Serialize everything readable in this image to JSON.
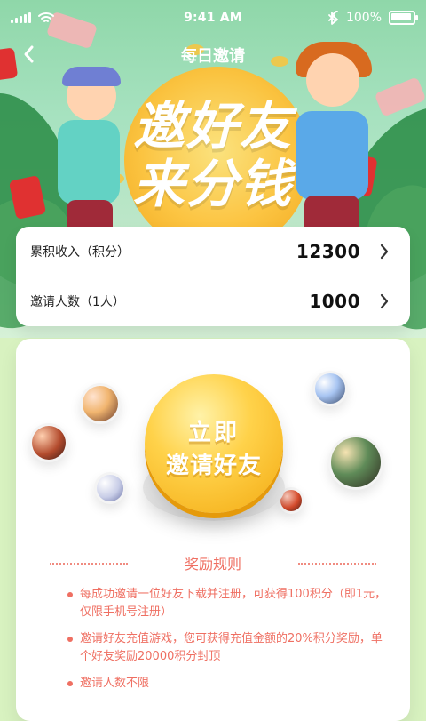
{
  "statusbar": {
    "time": "9:41 AM",
    "battery_text": "100%"
  },
  "nav": {
    "title": "每日邀请"
  },
  "hero": {
    "title_line1": "邀好友",
    "title_line2": "来分钱"
  },
  "stats": [
    {
      "label": "累积收入（积分）",
      "value": "12300"
    },
    {
      "label": "邀请人数（1人）",
      "value": "1000"
    }
  ],
  "invite_button": {
    "line1": "立即",
    "line2": "邀请好友"
  },
  "rules": {
    "title": "奖励规则",
    "items": [
      "每成功邀请一位好友下载并注册，可获得100积分（即1元，仅限手机号注册）",
      "邀请好友充值游戏，您可获得充值金额的20%积分奖励，单个好友奖励20000积分封顶",
      "邀请人数不限"
    ]
  },
  "colors": {
    "accent_text": "#ef6f62",
    "hero_gradient_top": "#8fd7a9",
    "page_bg": "#d8f2c0"
  },
  "icons": {
    "back": "chevron-left-icon",
    "row_arrow": "chevron-right-icon",
    "wifi": "wifi-icon",
    "bluetooth": "bluetooth-icon",
    "battery": "battery-icon",
    "signal": "signal-icon"
  }
}
